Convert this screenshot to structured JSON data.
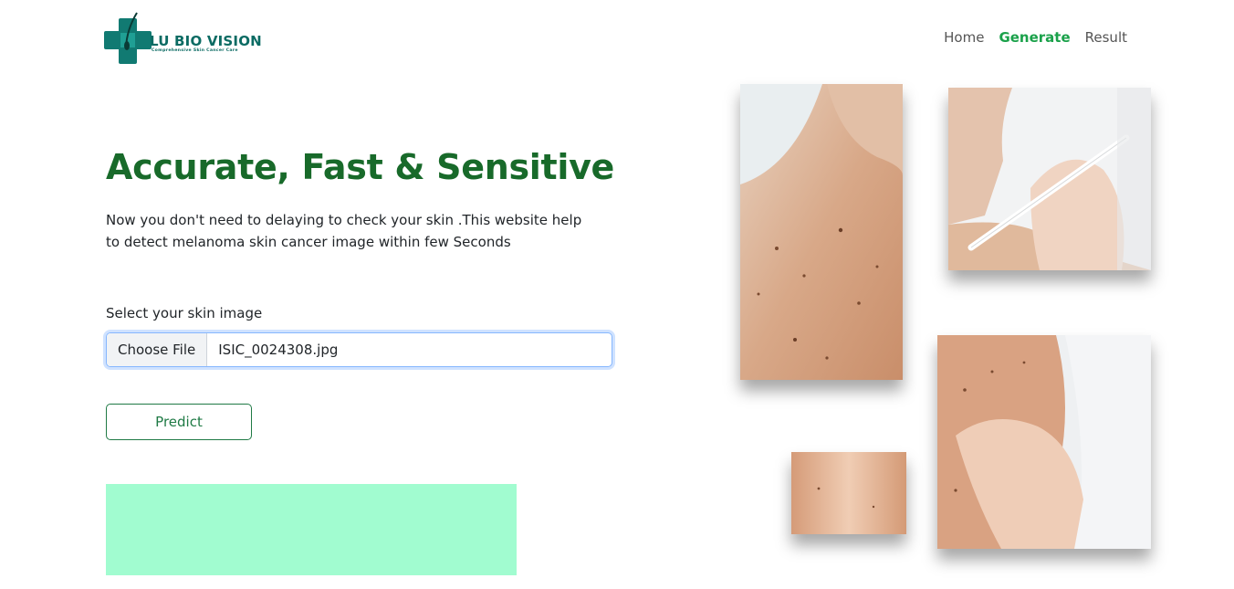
{
  "brand": {
    "name": "LU BIO VISION",
    "tagline": "Comprehensive Skin Cancer Care",
    "primary_color": "#0b6b63"
  },
  "nav": {
    "items": [
      {
        "label": "Home",
        "active": false
      },
      {
        "label": "Generate",
        "active": true
      },
      {
        "label": "Result",
        "active": false
      }
    ],
    "active_color": "#1aa14a"
  },
  "hero": {
    "title": "Accurate, Fast & Sensitive",
    "description": "Now you don't need to delaying to check your skin .This website help to detect melanoma skin cancer image within few Seconds",
    "title_color": "#186a2a"
  },
  "upload": {
    "label": "Select your skin image",
    "button_label": "Choose File",
    "file_name": "ISIC_0024308.jpg"
  },
  "predict": {
    "label": "Predict"
  },
  "result": {
    "background": "#a1fcd0"
  },
  "images": [
    {
      "name": "shoulder-moles-photo"
    },
    {
      "name": "marking-mole-photo"
    },
    {
      "name": "skin-closeup-photo"
    },
    {
      "name": "doctor-examining-photo"
    }
  ]
}
